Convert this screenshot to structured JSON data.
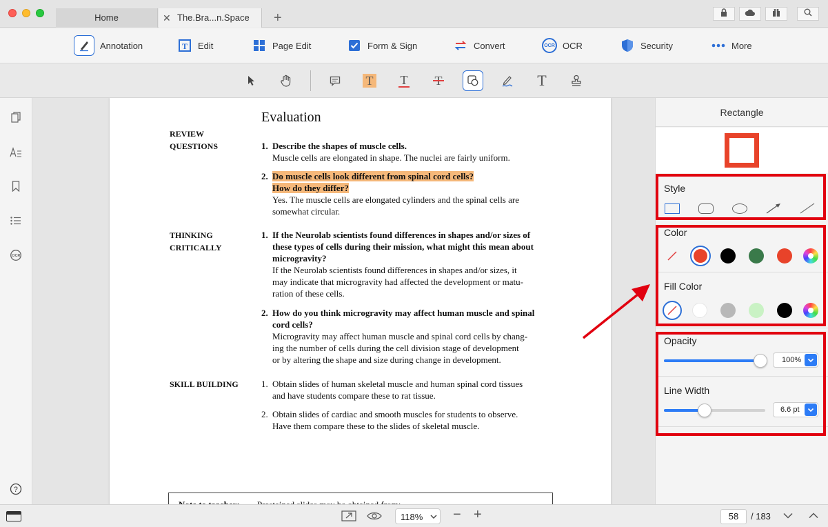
{
  "window": {
    "tabs": [
      {
        "label": "Home"
      },
      {
        "label": "The.Bra...n.Space"
      }
    ],
    "new_tab": "+"
  },
  "main_toolbar": {
    "items": [
      {
        "label": "Annotation",
        "icon": "annotation-pen-icon"
      },
      {
        "label": "Edit",
        "icon": "edit-text-icon"
      },
      {
        "label": "Page Edit",
        "icon": "page-grid-icon"
      },
      {
        "label": "Form & Sign",
        "icon": "checkbox-icon"
      },
      {
        "label": "Convert",
        "icon": "convert-arrows-icon"
      },
      {
        "label": "OCR",
        "icon": "ocr-icon"
      },
      {
        "label": "Security",
        "icon": "shield-icon"
      },
      {
        "label": "More",
        "icon": "more-dots-icon"
      }
    ],
    "ocr_badge": "OCR"
  },
  "annotation_toolbar": {
    "tools": [
      "select-arrow-icon",
      "hand-icon",
      "comment-icon",
      "highlight-icon",
      "underline-icon",
      "strikethrough-icon",
      "shape-icon",
      "pencil-icon",
      "text-icon",
      "stamp-icon"
    ],
    "glyph_t": "T"
  },
  "document": {
    "title": "Evaluation",
    "sections": [
      {
        "heading_lines": [
          "REVIEW",
          "QUESTIONS"
        ],
        "items": [
          {
            "num": "1.",
            "question": [
              "Describe the shapes of muscle cells."
            ],
            "answer": [
              "Muscle cells are elongated in shape. The nuclei are fairly uniform."
            ]
          },
          {
            "num": "2.",
            "question": [
              "Do muscle cells look different from spinal cord cells?",
              "How do they differ?"
            ],
            "answer": [
              "Yes. The muscle cells are elongated cylinders and the spinal cells are",
              "somewhat circular."
            ]
          }
        ]
      },
      {
        "heading_lines": [
          "THINKING",
          "CRITICALLY"
        ],
        "items": [
          {
            "num": "1.",
            "question": [
              "If the Neurolab scientists found differences in shapes and/or sizes of",
              "these types of cells during their mission, what might this mean about",
              "microgravity?"
            ],
            "answer": [
              "If the Neurolab scientists found differences in shapes and/or sizes, it",
              "may indicate that microgravity had affected the development or matu-",
              "ration of these cells."
            ]
          },
          {
            "num": "2.",
            "question": [
              "How do you think microgravity may affect human muscle and spinal",
              "cord cells?"
            ],
            "answer": [
              "Microgravity may affect human muscle and spinal cord cells by chang-",
              "ing the number of cells during the cell division stage of development",
              "or by altering the shape and size during change in development."
            ]
          }
        ]
      },
      {
        "heading_lines": [
          "SKILL BUILDING"
        ],
        "items": [
          {
            "num": "1.",
            "question": [],
            "answer": [
              "Obtain slides of human skeletal muscle and human spinal cord tissues",
              "and have students compare these to rat tissue."
            ]
          },
          {
            "num": "2.",
            "question": [],
            "answer": [
              "Obtain slides of cardiac and smooth muscles for students to observe.",
              "Have them compare these to the slides of skeletal muscle."
            ]
          }
        ]
      }
    ],
    "note_label": "Note to teacher:",
    "note_text": "Prestained slides may be obtained from:"
  },
  "right_panel": {
    "title": "Rectangle",
    "style_label": "Style",
    "color_label": "Color",
    "fill_color_label": "Fill Color",
    "opacity_label": "Opacity",
    "opacity_value": "100%",
    "opacity_level": 1.0,
    "line_width_label": "Line Width",
    "line_width_value": "6.6 pt",
    "line_width_level": 0.4,
    "color_swatches": [
      "none",
      "#e8432a",
      "#000000",
      "#3a7a4a",
      "#e8432a",
      "rainbow"
    ],
    "fill_swatches": [
      "none",
      "#ffffff",
      "#b8b8b8",
      "#c9f2c4",
      "#000000",
      "rainbow"
    ],
    "preview_color": "#e8432a",
    "highlight_color": "#f5b87a",
    "annotation_red": "#e1000f"
  },
  "status_bar": {
    "zoom": "118%",
    "page_current": "58",
    "page_total": "/ 183",
    "zoom_out": "−",
    "zoom_in": "+"
  }
}
